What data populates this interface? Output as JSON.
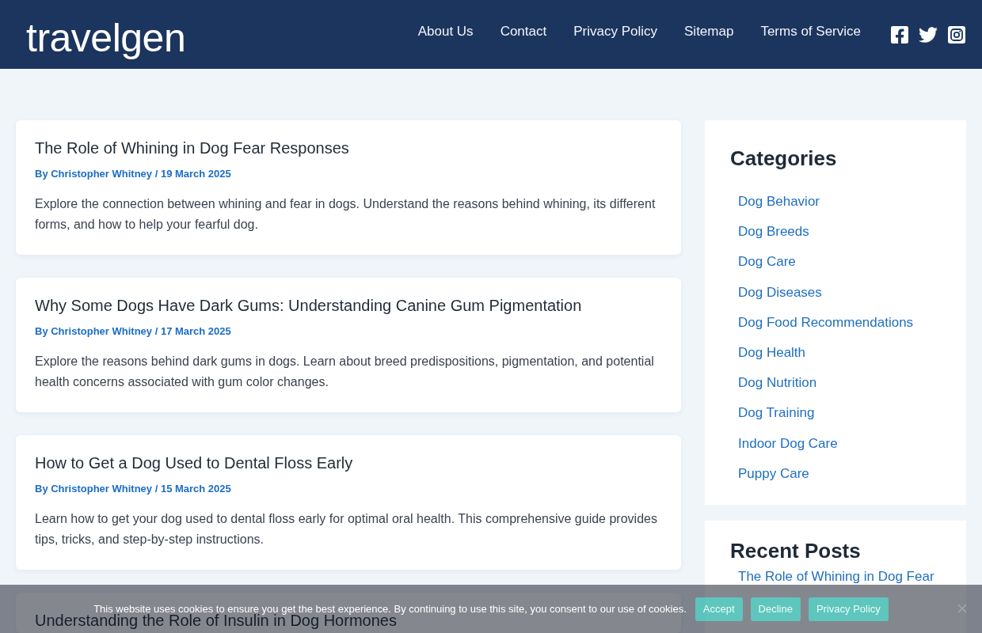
{
  "header": {
    "logo": "travelgen",
    "nav": [
      "About Us",
      "Contact",
      "Privacy Policy",
      "Sitemap",
      "Terms of Service"
    ],
    "social": [
      {
        "kind": "facebook"
      },
      {
        "kind": "twitter"
      },
      {
        "kind": "instagram"
      }
    ]
  },
  "posts": [
    {
      "title": "The Role of Whining in Dog Fear Responses",
      "meta": "By Christopher Whitney / 19 March 2025",
      "excerpt": "Explore the connection between whining and fear in dogs. Understand the reasons behind whining, its different forms, and how to help your fearful dog."
    },
    {
      "title": "Why Some Dogs Have Dark Gums: Understanding Canine Gum Pigmentation",
      "meta": "By Christopher Whitney / 17 March 2025",
      "excerpt": "Explore the reasons behind dark gums in dogs. Learn about breed predispositions, pigmentation, and potential health concerns associated with gum color changes."
    },
    {
      "title": "How to Get a Dog Used to Dental Floss Early",
      "meta": "By Christopher Whitney / 15 March 2025",
      "excerpt": "Learn how to get your dog used to dental floss early for optimal oral health. This comprehensive guide provides tips, tricks, and step-by-step instructions."
    },
    {
      "title": "Understanding the Role of Insulin in Dog Hormones"
    }
  ],
  "sidebar": {
    "widgets": [
      {
        "title": "Categories",
        "links": [
          "Dog Behavior",
          "Dog Breeds",
          "Dog Care",
          "Dog Diseases",
          "Dog Food Recommendations",
          "Dog Health",
          "Dog Nutrition",
          "Dog Training",
          "Indoor Dog Care",
          "Puppy Care"
        ]
      },
      {
        "title": "Recent Posts",
        "links": [
          "The Role of Whining in Dog Fear"
        ]
      }
    ]
  },
  "cookie_banner": {
    "message": "This website uses cookies to ensure you get the best experience. By continuing to use this site, you consent to our use of cookies.",
    "buttons": [
      "Accept",
      "Decline",
      "Privacy Policy"
    ]
  }
}
